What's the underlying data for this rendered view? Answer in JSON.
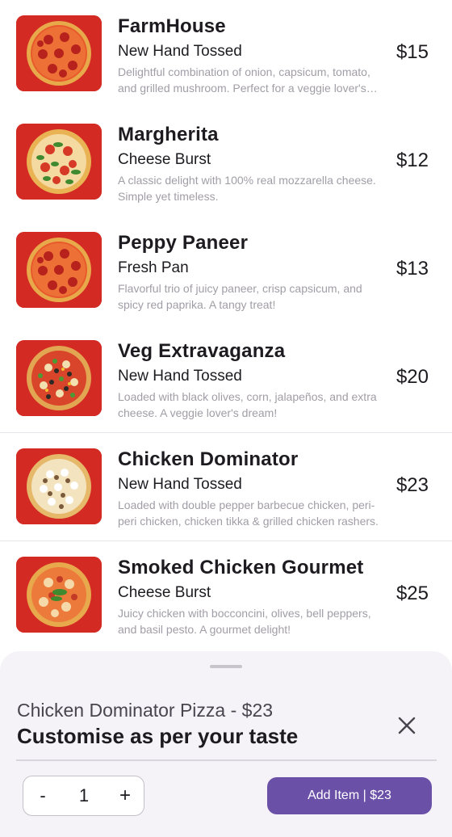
{
  "menu": {
    "items": [
      {
        "name": "FarmHouse",
        "crust": "New Hand Tossed",
        "description": "Delightful combination of onion, capsicum, tomato, and grilled mushroom. Perfect for a veggie lover's meal.",
        "price": "$15",
        "image": "pepperoni-pizza-image"
      },
      {
        "name": "Margherita",
        "crust": "Cheese Burst",
        "description": "A classic delight with 100% real mozzarella cheese. Simple yet timeless.",
        "price": "$12",
        "image": "basil-tomato-pizza-image"
      },
      {
        "name": "Peppy Paneer",
        "crust": "Fresh Pan",
        "description": "Flavorful trio of juicy paneer, crisp capsicum, and spicy red paprika. A tangy treat!",
        "price": "$13",
        "image": "pepperoni-pizza-image"
      },
      {
        "name": "Veg Extravaganza",
        "crust": "New Hand Tossed",
        "description": "Loaded with black olives, corn, jalapeños, and extra cheese. A veggie lover's dream!",
        "price": "$20",
        "image": "veggie-pizza-image"
      },
      {
        "name": "Chicken Dominator",
        "crust": "New Hand Tossed",
        "description": "Loaded with double pepper barbecue chicken, peri-peri chicken, chicken tikka & grilled chicken rashers.",
        "price": "$23",
        "image": "cheese-mushroom-pizza-image"
      },
      {
        "name": "Smoked Chicken Gourmet",
        "crust": "Cheese Burst",
        "description": "Juicy chicken with bocconcini, olives, bell peppers, and basil pesto. A gourmet delight!",
        "price": "$25",
        "image": "gourmet-pizza-image"
      }
    ]
  },
  "sheet": {
    "subtitle": "Chicken Dominator Pizza - $23",
    "title": "Customise as per your taste",
    "close_icon": "close-icon",
    "quantity": {
      "minus_label": "-",
      "value": "1",
      "plus_label": "+"
    },
    "add_button_label": "Add Item | $23"
  },
  "colors": {
    "accent": "#6b50a8",
    "thumb_background": "#d42a24",
    "sheet_background": "#f6f3f8",
    "description_text": "#a19da6"
  }
}
